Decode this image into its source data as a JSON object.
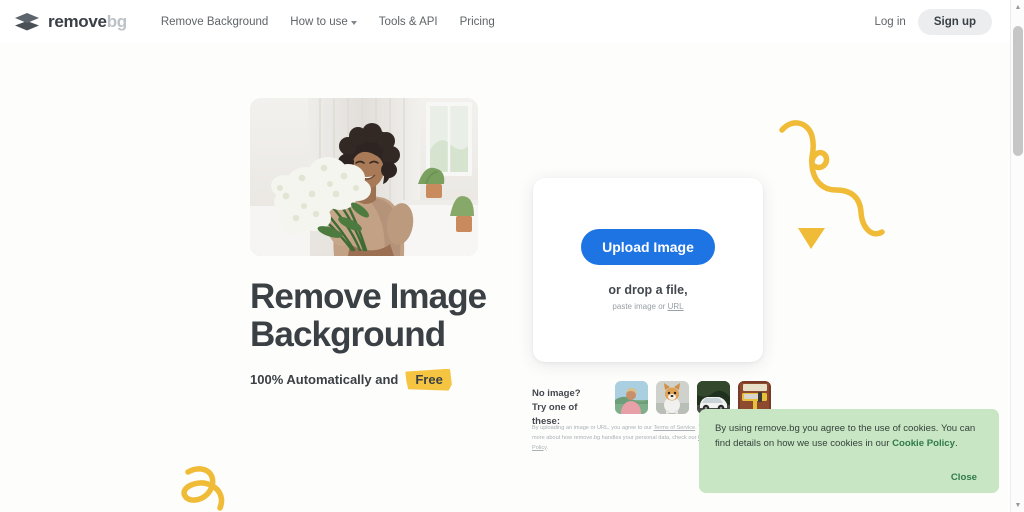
{
  "header": {
    "logo": {
      "icon": "stacked-diamond-logo-icon",
      "name_primary": "remove",
      "name_secondary": "bg"
    },
    "nav": [
      {
        "label": "Remove Background",
        "has_caret": false
      },
      {
        "label": "How to use",
        "has_caret": true
      },
      {
        "label": "Tools & API",
        "has_caret": false
      },
      {
        "label": "Pricing",
        "has_caret": false
      }
    ],
    "login_label": "Log in",
    "signup_label": "Sign up"
  },
  "hero": {
    "title_line1": "Remove Image",
    "title_line2": "Background",
    "subtitle_prefix": "100% Automatically and",
    "badge_label": "Free",
    "photo_alt": "smiling-woman-holding-flower-bouquet"
  },
  "upload": {
    "button_label": "Upload Image",
    "drop_text": "or drop a file,",
    "paste_prefix": "paste image or ",
    "paste_link": "URL"
  },
  "samples": {
    "label_line1": "No image?",
    "label_line2": "Try one of these:",
    "thumbs": [
      {
        "name": "sample-thumb-person"
      },
      {
        "name": "sample-thumb-dog"
      },
      {
        "name": "sample-thumb-car"
      },
      {
        "name": "sample-thumb-product"
      }
    ]
  },
  "legal": {
    "part1": "By uploading an image or URL, you agree to our ",
    "link1": "Terms of Service",
    "part2": ". To learn more about how remove.bg handles your personal data, check our ",
    "link2": "Privacy Policy",
    "part3": "."
  },
  "cookie": {
    "text_part1": "By using remove.bg you agree to the use of cookies. You can find details on how we use cookies in our ",
    "link_label": "Cookie Policy",
    "text_part2": ".",
    "close_label": "Close"
  },
  "scrollbar": {
    "up_arrow": "▲",
    "down_arrow": "▼"
  },
  "colors": {
    "accent_blue": "#1f74e4",
    "badge_yellow": "#f5c542",
    "cookie_green": "#c8e6c4",
    "cookie_link_green": "#2f7a47",
    "text_dark": "#3b4045",
    "page_bg": "#fdfdfc"
  }
}
